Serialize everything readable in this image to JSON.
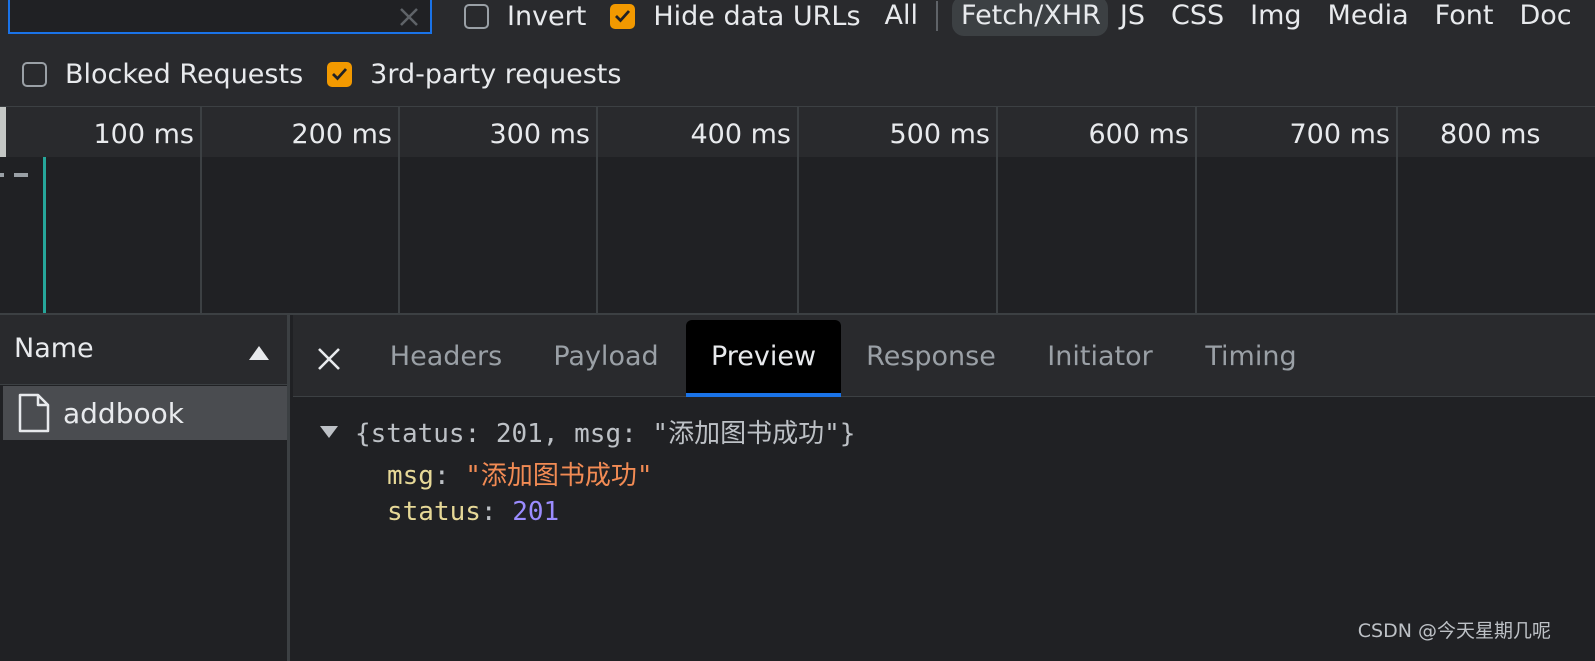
{
  "filters": {
    "invert_label": "Invert",
    "invert_checked": false,
    "hide_data_urls_label": "Hide data URLs",
    "hide_data_urls_checked": true,
    "types": [
      "All",
      "Fetch/XHR",
      "JS",
      "CSS",
      "Img",
      "Media",
      "Font",
      "Doc"
    ],
    "active_type": "Fetch/XHR",
    "blocked_requests_label": "Blocked Requests",
    "blocked_requests_checked": false,
    "third_party_label": "3rd-party requests",
    "third_party_checked": true
  },
  "timeline": {
    "labels": [
      "100 ms",
      "200 ms",
      "300 ms",
      "400 ms",
      "500 ms",
      "600 ms",
      "700 ms",
      "800 ms"
    ]
  },
  "requests": {
    "column_header": "Name",
    "sort_icon": "sort-ascending-icon",
    "items": [
      {
        "name": "addbook",
        "icon": "file-icon"
      }
    ]
  },
  "details": {
    "close_icon": "close-icon",
    "tabs": [
      "Headers",
      "Payload",
      "Preview",
      "Response",
      "Initiator",
      "Timing"
    ],
    "active_tab": "Preview",
    "preview": {
      "summary": "{status: 201, msg: \"添加图书成功\"}",
      "props": [
        {
          "key": "msg",
          "value": "\"添加图书成功\""
        },
        {
          "key": "status",
          "value": "201"
        }
      ]
    }
  },
  "watermark": "CSDN @今天星期几呢",
  "colors": {
    "accent": "#1a73e8",
    "checkbox_on": "#f29900",
    "json_key": "#e6d897",
    "json_string": "#f28b54",
    "json_number": "#9b8cff",
    "waterfall_bar": "#26a69a"
  }
}
